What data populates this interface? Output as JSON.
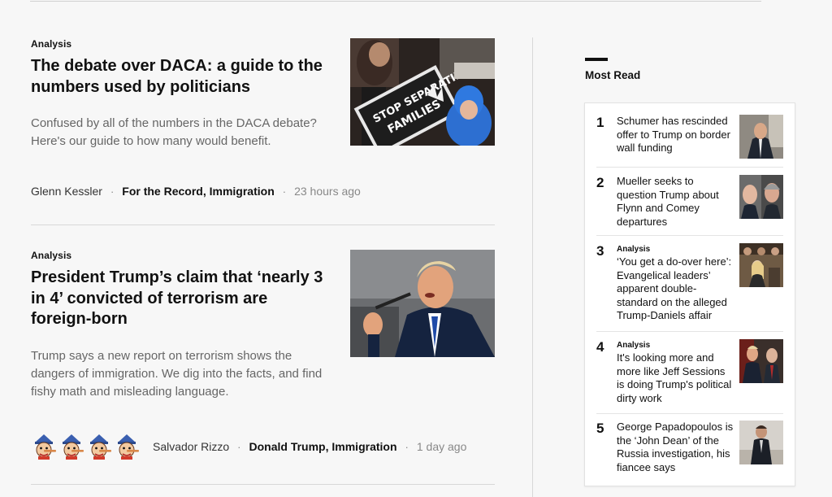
{
  "articles": [
    {
      "kicker": "Analysis",
      "headline": "The debate over DACA: a guide to the numbers used by politicians",
      "blurb": "Confused by all of the numbers in the DACA debate? Here's our guide to how many would benefit.",
      "author": "Glenn Kessler",
      "section": "For the Record, Immigration",
      "time": "23 hours ago",
      "image_alt": "protest-photo"
    },
    {
      "kicker": "Analysis",
      "headline": "President Trump’s claim that ‘nearly 3 in 4’ convicted of terrorism are foreign-born",
      "blurb": "Trump says a new report on terrorism shows the dangers of immigration. We dig into the facts, and find fishy math and misleading language.",
      "author": "Salvador Rizzo",
      "section": "Donald Trump, Immigration",
      "time": "1 day ago",
      "rating_pinocchios": 4,
      "image_alt": "speaker-photo"
    }
  ],
  "byline_separator": "·",
  "most_read": {
    "title": "Most Read",
    "items": [
      {
        "rank": "1",
        "kicker": "",
        "text": "Schumer has rescinded offer to Trump on border wall funding"
      },
      {
        "rank": "2",
        "kicker": "",
        "text": "Mueller seeks to question Trump about Flynn and Comey departures"
      },
      {
        "rank": "3",
        "kicker": "Analysis",
        "text": "‘You get a do-over here’: Evangelical leaders’ apparent double-standard on the alleged Trump-Daniels affair"
      },
      {
        "rank": "4",
        "kicker": "Analysis",
        "text": "It's looking more and more like Jeff Sessions is doing Trump's political dirty work"
      },
      {
        "rank": "5",
        "kicker": "",
        "text": "George Papadopoulos is the ‘John Dean’ of the Russia investigation, his fiancee says"
      }
    ]
  },
  "colors": {
    "background": "#f7f7f7",
    "text": "#111111",
    "muted": "#666666",
    "rule": "#d8d8d8"
  }
}
